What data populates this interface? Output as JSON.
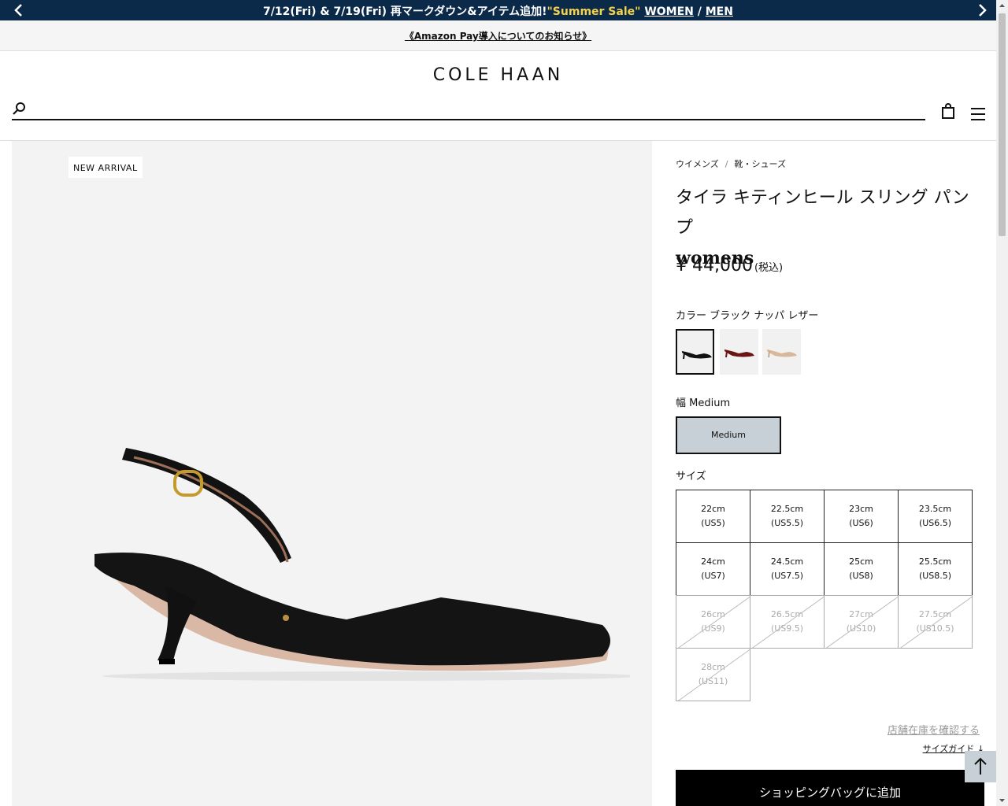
{
  "promo": {
    "text_before": "7/12(Fri) & 7/19(Fri) 再マークダウン&アイテム追加!",
    "sale": "\"Summer Sale\"",
    "women": "WOMEN",
    "slash": "/",
    "men": "MEN"
  },
  "notice": {
    "link": "《Amazon Pay導入についてのお知らせ》"
  },
  "header": {
    "logo": "COLE HAAN",
    "search_placeholder": ""
  },
  "gallery": {
    "badge": "NEW ARRIVAL"
  },
  "breadcrumb": {
    "items": [
      "ウイメンズ",
      "靴・シューズ"
    ],
    "separator": "/"
  },
  "product": {
    "title": "タイラ キティンヒール スリング パンプ",
    "title_sub": "womens",
    "currency": "¥",
    "price": "44,000",
    "tax_note": "(税込)"
  },
  "color": {
    "label": "カラー",
    "selected": "ブラック ナッパ レザー",
    "swatches": [
      {
        "name": "black",
        "color": "#111111"
      },
      {
        "name": "burgundy",
        "color": "#6a1414"
      },
      {
        "name": "beige",
        "color": "#d8b89a"
      }
    ]
  },
  "width": {
    "label": "幅",
    "selected": "Medium",
    "options": [
      "Medium"
    ]
  },
  "size": {
    "label": "サイズ",
    "options": [
      {
        "cm": "22cm",
        "us": "(US5)",
        "available": true
      },
      {
        "cm": "22.5cm",
        "us": "(US5.5)",
        "available": true
      },
      {
        "cm": "23cm",
        "us": "(US6)",
        "available": true
      },
      {
        "cm": "23.5cm",
        "us": "(US6.5)",
        "available": true
      },
      {
        "cm": "24cm",
        "us": "(US7)",
        "available": true
      },
      {
        "cm": "24.5cm",
        "us": "(US7.5)",
        "available": true
      },
      {
        "cm": "25cm",
        "us": "(US8)",
        "available": true
      },
      {
        "cm": "25.5cm",
        "us": "(US8.5)",
        "available": true
      },
      {
        "cm": "26cm",
        "us": "(US9)",
        "available": false
      },
      {
        "cm": "26.5cm",
        "us": "(US9.5)",
        "available": false
      },
      {
        "cm": "27cm",
        "us": "(US10)",
        "available": false
      },
      {
        "cm": "27.5cm",
        "us": "(US10.5)",
        "available": false
      },
      {
        "cm": "28cm",
        "us": "(US11)",
        "available": false
      }
    ]
  },
  "actions": {
    "store_stock": "店舗在庫を確認する",
    "size_guide": "サイズガイド ↓",
    "add_to_bag": "ショッピングバッグに追加"
  },
  "colors": {
    "promo_bg": "#0b2a4a",
    "sale_yellow": "#f5d34a",
    "selected_fill": "#c6d0d6"
  }
}
